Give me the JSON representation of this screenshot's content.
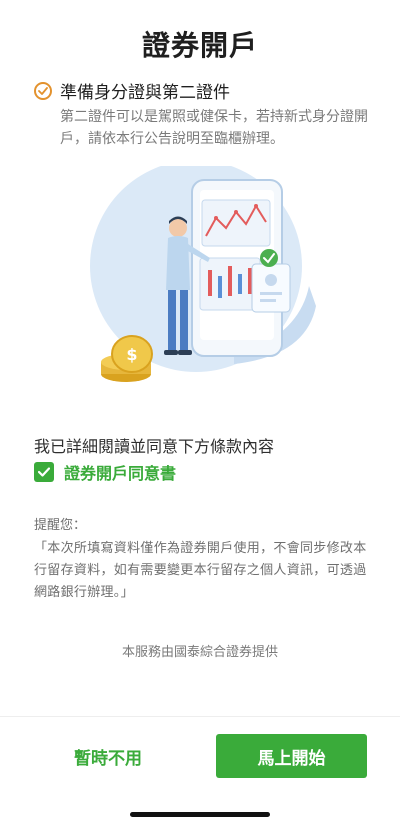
{
  "header": {
    "title": "證券開戶"
  },
  "preparation": {
    "title": "準備身分證與第二證件",
    "description": "第二證件可以是駕照或健保卡，若持新式身分證開戶，請依本行公告說明至臨櫃辦理。",
    "icon": "checkmark-circle-icon",
    "accent_color": "#e3922e"
  },
  "illustration": {
    "icon": "account-opening-illustration"
  },
  "agreement": {
    "intro": "我已詳細閱讀並同意下方條款內容",
    "link_label": "證券開戶同意書",
    "checked": true,
    "accent_color": "#3aab3a"
  },
  "reminder": {
    "label": "提醒您：",
    "text": "「本次所填寫資料僅作為證券開戶使用，不會同步修改本行留存資料，如有需要變更本行留存之個人資訊，可透過網路銀行辦理。」"
  },
  "footer_note": "本服務由國泰綜合證券提供",
  "actions": {
    "later_label": "暫時不用",
    "start_label": "馬上開始",
    "primary_color": "#3aab3a"
  }
}
